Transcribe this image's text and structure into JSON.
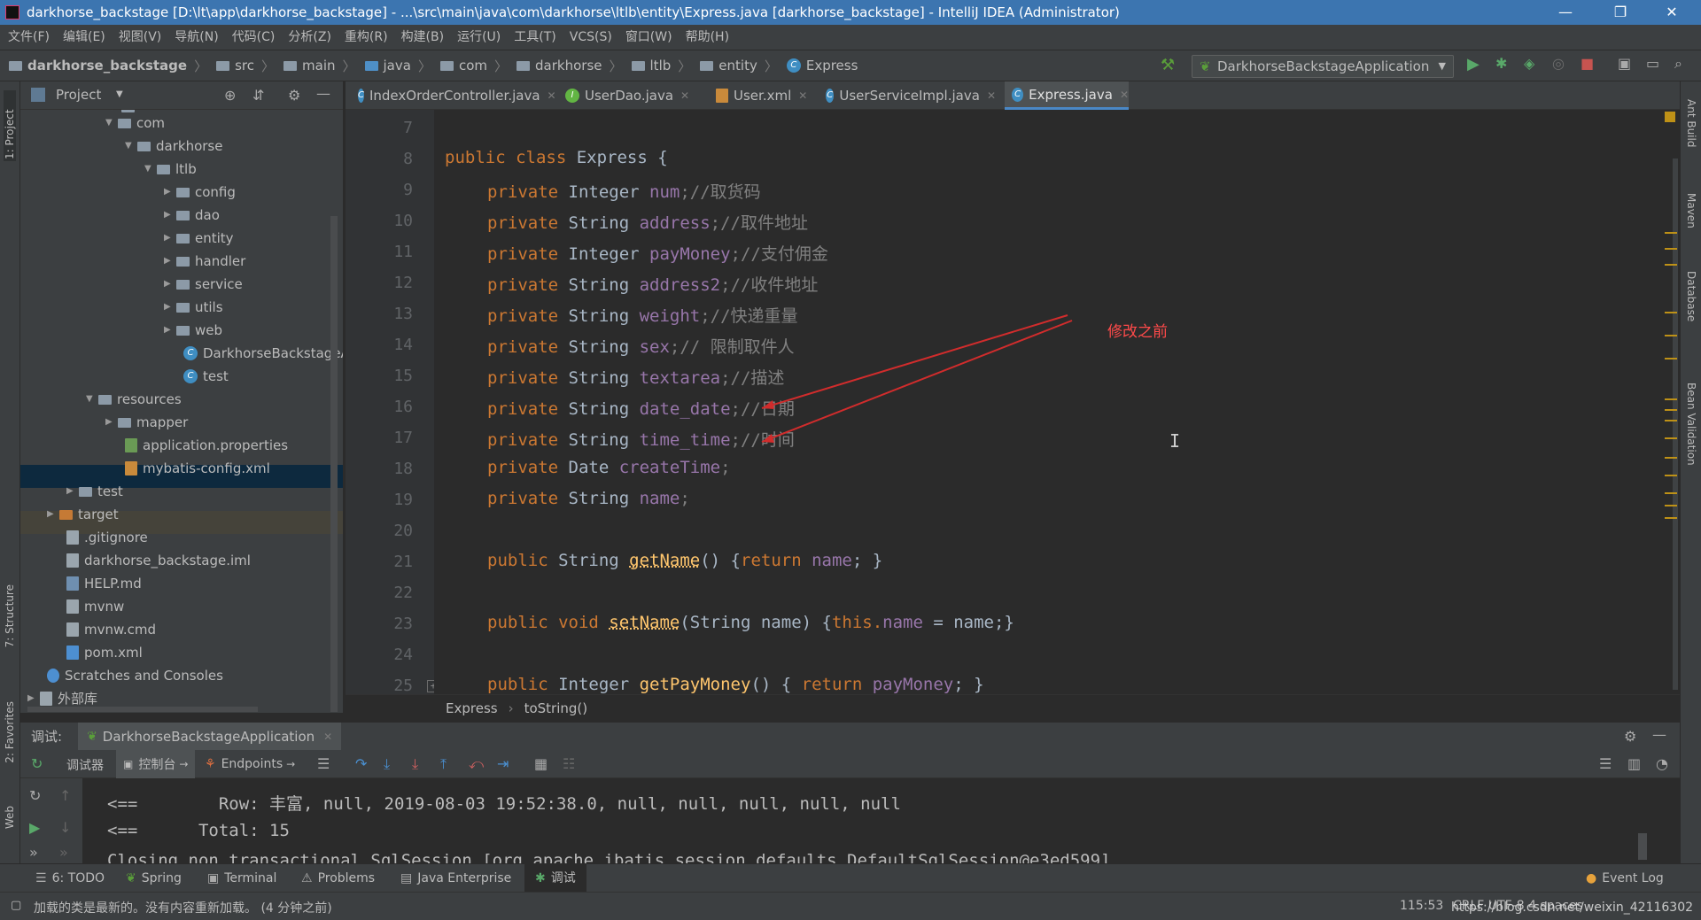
{
  "window": {
    "title": "darkhorse_backstage [D:\\lt\\app\\darkhorse_backstage] - ...\\src\\main\\java\\com\\darkhorse\\ltlb\\entity\\Express.java [darkhorse_backstage] - IntelliJ IDEA (Administrator)",
    "minimize": "—",
    "restore": "❐",
    "close": "✕"
  },
  "menu": [
    "文件(F)",
    "编辑(E)",
    "视图(V)",
    "导航(N)",
    "代码(C)",
    "分析(Z)",
    "重构(R)",
    "构建(B)",
    "运行(U)",
    "工具(T)",
    "VCS(S)",
    "窗口(W)",
    "帮助(H)"
  ],
  "breadcrumb": [
    "darkhorse_backstage",
    "src",
    "main",
    "java",
    "com",
    "darkhorse",
    "ltlb",
    "entity",
    "Express"
  ],
  "run_config": "DarkhorseBackstageApplication",
  "project_panel": {
    "title": "Project",
    "tree": [
      {
        "label": "com",
        "indent": 0
      },
      {
        "label": "darkhorse",
        "indent": 1
      },
      {
        "label": "ltlb",
        "indent": 2
      },
      {
        "label": "config",
        "indent": 3
      },
      {
        "label": "dao",
        "indent": 3
      },
      {
        "label": "entity",
        "indent": 3
      },
      {
        "label": "handler",
        "indent": 3
      },
      {
        "label": "service",
        "indent": 3
      },
      {
        "label": "utils",
        "indent": 3
      },
      {
        "label": "web",
        "indent": 3
      },
      {
        "label": "DarkhorseBackstageA",
        "indent": 3
      },
      {
        "label": "test",
        "indent": 3
      },
      {
        "label": "resources",
        "indent": 0
      },
      {
        "label": "mapper",
        "indent": 1
      },
      {
        "label": "application.properties",
        "indent": 1
      },
      {
        "label": "mybatis-config.xml",
        "indent": 1
      },
      {
        "label": "test",
        "indent": 0
      },
      {
        "label": "target",
        "indent": 0
      },
      {
        "label": ".gitignore",
        "indent": 0
      },
      {
        "label": "darkhorse_backstage.iml",
        "indent": 0
      },
      {
        "label": "HELP.md",
        "indent": 0
      },
      {
        "label": "mvnw",
        "indent": 0
      },
      {
        "label": "mvnw.cmd",
        "indent": 0
      },
      {
        "label": "pom.xml",
        "indent": 0
      },
      {
        "label": "Scratches and Consoles",
        "indent": 0
      },
      {
        "label": "外部库",
        "indent": 0
      }
    ]
  },
  "tabs": [
    {
      "label": "IndexOrderController.java"
    },
    {
      "label": "UserDao.java"
    },
    {
      "label": "User.xml"
    },
    {
      "label": "UserServiceImpl.java"
    },
    {
      "label": "Express.java"
    }
  ],
  "code": {
    "line_numbers": [
      "7",
      "8",
      "9",
      "10",
      "11",
      "12",
      "13",
      "14",
      "15",
      "16",
      "17",
      "18",
      "19",
      "20",
      "21",
      "22",
      "23",
      "24",
      "25"
    ],
    "annotation": "修改之前",
    "lines": {
      "l8": {
        "kw": "public class ",
        "name": "Express",
        "rest": " {"
      },
      "l9": {
        "kw": "private ",
        "type": "Integer ",
        "field": "num",
        "comment": ";//取货码"
      },
      "l10": {
        "kw": "private ",
        "type": "String ",
        "field": "address",
        "comment": ";//取件地址"
      },
      "l11": {
        "kw": "private ",
        "type": "Integer ",
        "field": "payMoney",
        "comment": ";//支付佣金"
      },
      "l12": {
        "kw": "private ",
        "type": "String ",
        "field": "address2",
        "comment": ";//收件地址"
      },
      "l13": {
        "kw": "private ",
        "type": "String ",
        "field": "weight",
        "comment": ";//快递重量"
      },
      "l14": {
        "kw": "private ",
        "type": "String ",
        "field": "sex",
        "comment": ";// 限制取件人"
      },
      "l15": {
        "kw": "private ",
        "type": "String ",
        "field": "textarea",
        "comment": ";//描述"
      },
      "l16": {
        "kw": "private ",
        "type": "String ",
        "field": "date_date",
        "comment": ";//日期"
      },
      "l17": {
        "kw": "private ",
        "type": "String ",
        "field": "time_time",
        "comment": ";//时间"
      },
      "l18": {
        "kw": "private ",
        "type": "Date ",
        "field": "createTime",
        "comment": ";"
      },
      "l19": {
        "kw": "private ",
        "type": "String ",
        "field": "name",
        "comment": ";"
      },
      "l21": {
        "kw": "public ",
        "type": "String ",
        "fn": "getName",
        "rest": "() {",
        "ret": "return ",
        "field": "name",
        "end": "; }"
      },
      "l23": {
        "kw": "public void ",
        "fn": "setName",
        "rest": "(String name) {",
        "this": "this.",
        "field": "name",
        "end": " = name;}"
      },
      "l25": {
        "kw": "public ",
        "type": "Integer ",
        "fn": "getPayMoney",
        "rest": "() { ",
        "ret": "return ",
        "field": "payMoney",
        "end": "; }"
      }
    }
  },
  "editor_breadcrumb": [
    "Express",
    "toString()"
  ],
  "debug": {
    "label": "调试:",
    "config": "DarkhorseBackstageApplication",
    "tabs": [
      "调试器",
      "控制台",
      "Endpoints"
    ],
    "console": [
      "<==        Row: 丰富, null, 2019-08-03 19:52:38.0, null, null, null, null, null",
      "<==      Total: 15",
      "Closing non transactional SqlSession [org.apache.ibatis.session.defaults.DefaultSqlSession@e3ed599]"
    ]
  },
  "bottom_tools": [
    "6: TODO",
    "Spring",
    "Terminal",
    "Problems",
    "Java Enterprise",
    "调试"
  ],
  "event_log": "Event Log",
  "left_strip": [
    "1: Project",
    "7: Structure",
    "2: Favorites",
    "Web"
  ],
  "right_strip": [
    "Ant Build",
    "Maven",
    "Database",
    "Bean Validation"
  ],
  "status": {
    "message": "加载的类是最新的。没有内容重新加载。 (4 分钟之前)",
    "position": "115:53",
    "encoding": "CRLF  UTF-8  4 spaces",
    "watermark": "https://blog.csdn.net/weixin_42116302"
  }
}
